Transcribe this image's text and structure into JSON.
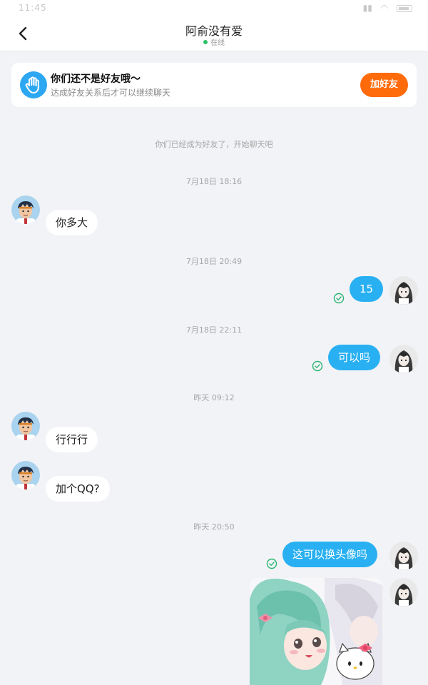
{
  "status_bar": {
    "time": "11:45"
  },
  "header": {
    "contact_name": "阿俞没有爱",
    "status": "在线",
    "colors": {
      "online": "#2bc16a"
    }
  },
  "friend_banner": {
    "icon": "waving-hand-icon",
    "title": "你们还不是好友哦～",
    "subtitle": "达成好友关系后才可以继续聊天",
    "button_label": "加好友",
    "colors": {
      "button": "#ff6a0b",
      "icon_bg": "#2da7f2"
    }
  },
  "chat": {
    "system_notice": "你们已经成为好友了，开始聊天吧",
    "colors": {
      "outgoing_bubble": "#29b0f2",
      "incoming_bubble": "#ffffff"
    },
    "timestamps": [
      "7月18日 18:16",
      "7月18日 20:49",
      "7月18日 22:11",
      "昨天 09:12",
      "昨天 20:50"
    ],
    "messages": [
      {
        "sender": "them",
        "text": "你多大"
      },
      {
        "sender": "me",
        "text": "15",
        "read": true
      },
      {
        "sender": "me",
        "text": "可以吗",
        "read": true
      },
      {
        "sender": "them",
        "text": "行行行"
      },
      {
        "sender": "them",
        "text": "加个QQ?"
      },
      {
        "sender": "me",
        "text": "这可以换头像吗",
        "read": true
      },
      {
        "sender": "me",
        "type": "image",
        "image": "anime-girls-with-hello-kitty"
      }
    ]
  }
}
